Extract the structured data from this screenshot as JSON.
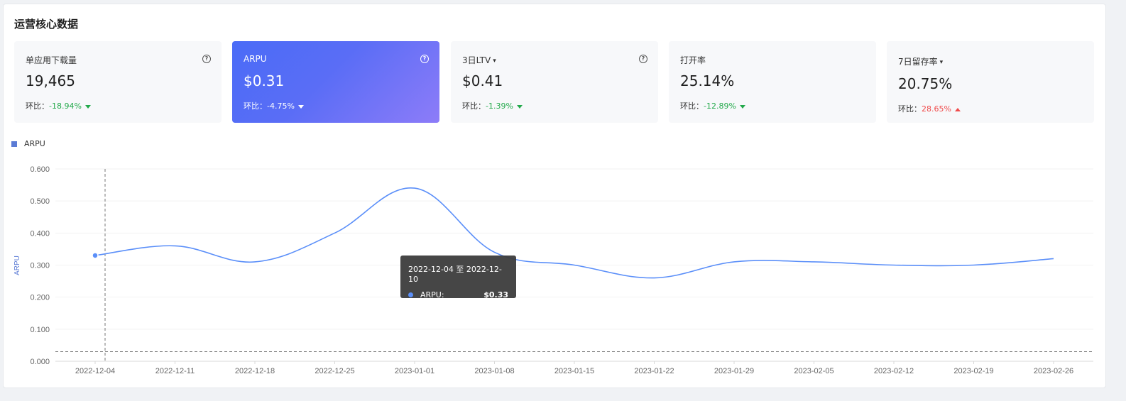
{
  "title": "运营核心数据",
  "cards": [
    {
      "label": "单应用下载量",
      "value": "19,465",
      "ratio_label": "环比：",
      "ratio": "-18.94%",
      "trend": "down",
      "has_help": true,
      "has_caret": false
    },
    {
      "label": "ARPU",
      "value": "$0.31",
      "ratio_label": "环比：",
      "ratio": "-4.75%",
      "trend": "down",
      "has_help": true,
      "has_caret": false,
      "active": true
    },
    {
      "label": "3日LTV",
      "value": "$0.41",
      "ratio_label": "环比：",
      "ratio": "-1.39%",
      "trend": "down",
      "has_help": true,
      "has_caret": true
    },
    {
      "label": "打开率",
      "value": "25.14%",
      "ratio_label": "环比：",
      "ratio": "-12.89%",
      "trend": "down",
      "has_help": false,
      "has_caret": false
    },
    {
      "label": "7日留存率",
      "value": "20.75%",
      "ratio_label": "环比：",
      "ratio": "28.65%",
      "trend": "up",
      "has_help": false,
      "has_caret": true
    }
  ],
  "colors": {
    "accent": "#5b8ff9",
    "up": "#f04b4b",
    "down": "#22a94a"
  },
  "tooltip": {
    "range": "2022-12-04 至 2022-12-10",
    "series": "ARPU:",
    "value": "$0.33"
  },
  "chart_data": {
    "type": "line",
    "ylabel": "ARPU",
    "legend": [
      "ARPU"
    ],
    "ylim": [
      0,
      0.6
    ],
    "yticks": [
      "0.000",
      "0.100",
      "0.200",
      "0.300",
      "0.400",
      "0.500",
      "0.600"
    ],
    "x": [
      "2022-12-04",
      "2022-12-11",
      "2022-12-18",
      "2022-12-25",
      "2023-01-01",
      "2023-01-08",
      "2023-01-15",
      "2023-01-22",
      "2023-01-29",
      "2023-02-05",
      "2023-02-12",
      "2023-02-19",
      "2023-02-26"
    ],
    "series": [
      {
        "name": "ARPU",
        "values": [
          0.33,
          0.36,
          0.31,
          0.4,
          0.54,
          0.34,
          0.3,
          0.26,
          0.31,
          0.31,
          0.3,
          0.3,
          0.32
        ]
      }
    ],
    "reference_line": 0.03,
    "hover_index": 0
  }
}
